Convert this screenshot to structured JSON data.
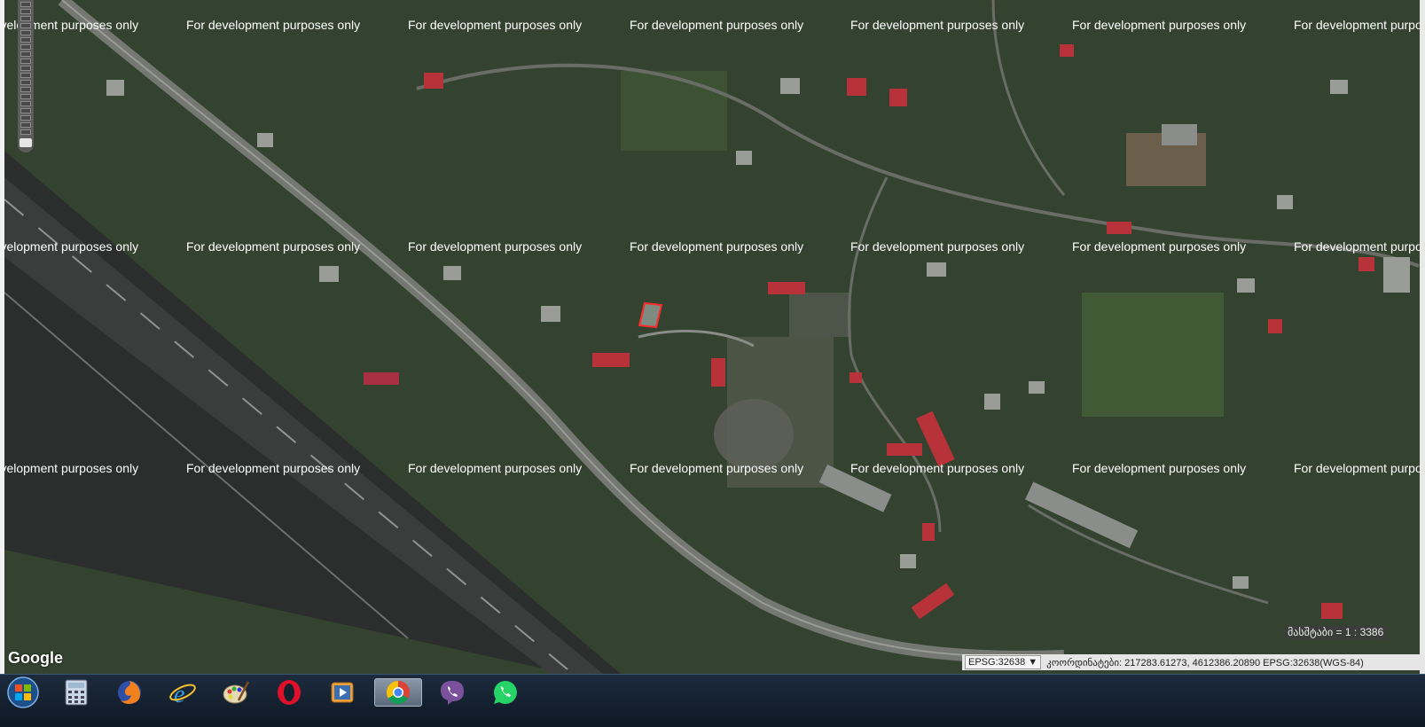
{
  "map": {
    "watermark_text": "For development purposes only",
    "provider_logo": "Google",
    "scale_text": "მასშტაბი = 1 : 3386"
  },
  "status_bar": {
    "epsg_selected": "EPSG:32638",
    "coordinates_text": "კოორდინატები: 217283.61273, 4612386.20890  EPSG:32638(WGS-84)"
  },
  "controls": {
    "zoom_slider": "zoom-slider"
  },
  "taskbar": {
    "items": [
      {
        "icon": "windows-start-icon"
      },
      {
        "icon": "calculator-icon"
      },
      {
        "icon": "firefox-icon"
      },
      {
        "icon": "internet-explorer-icon"
      },
      {
        "icon": "paint-icon"
      },
      {
        "icon": "opera-icon"
      },
      {
        "icon": "media-player-icon"
      },
      {
        "icon": "chrome-icon",
        "active": true
      },
      {
        "icon": "viber-icon"
      },
      {
        "icon": "whatsapp-icon"
      }
    ]
  },
  "colors": {
    "highlight_parcel": "#ff2a2a",
    "taskbar_bg": "#14202e",
    "roof_red": "#b8323a"
  }
}
